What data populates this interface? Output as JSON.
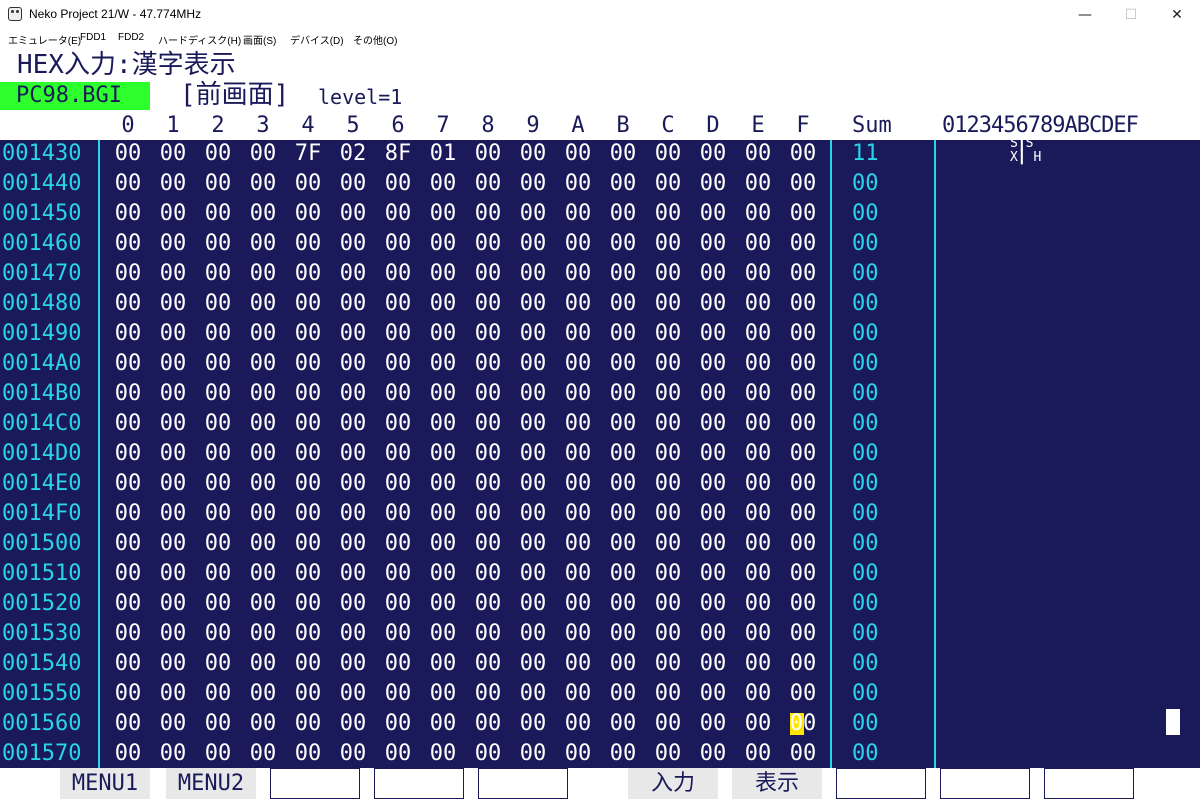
{
  "window": {
    "title": "Neko Project 21/W - 47.774MHz",
    "minimize_glyph": "—",
    "maximize_glyph": "☐",
    "close_glyph": "✕"
  },
  "menu": [
    "エミュレータ(E)",
    "FDD1",
    "FDD2",
    "ハードディスク(H)",
    "画面(S)",
    "デバイス(D)",
    "その他(O)"
  ],
  "editor": {
    "mode_title": "HEX入力:漢字表示",
    "file_name": "PC98.BGI",
    "screen_label": "[前画面]",
    "level_label": "level=1",
    "column_headers": [
      "0",
      "1",
      "2",
      "3",
      "4",
      "5",
      "6",
      "7",
      "8",
      "9",
      "A",
      "B",
      "C",
      "D",
      "E",
      "F"
    ],
    "sum_header": "Sum",
    "ascii_header": "0123456789ABCDEF",
    "rows": [
      {
        "addr": "001430",
        "bytes": [
          "00",
          "00",
          "00",
          "00",
          "7F",
          "02",
          "8F",
          "01",
          "00",
          "00",
          "00",
          "00",
          "00",
          "00",
          "00",
          "00"
        ],
        "sum": "11",
        "ascii": "S┃S\nX┃ H"
      },
      {
        "addr": "001440",
        "bytes": [
          "00",
          "00",
          "00",
          "00",
          "00",
          "00",
          "00",
          "00",
          "00",
          "00",
          "00",
          "00",
          "00",
          "00",
          "00",
          "00"
        ],
        "sum": "00",
        "ascii": ""
      },
      {
        "addr": "001450",
        "bytes": [
          "00",
          "00",
          "00",
          "00",
          "00",
          "00",
          "00",
          "00",
          "00",
          "00",
          "00",
          "00",
          "00",
          "00",
          "00",
          "00"
        ],
        "sum": "00",
        "ascii": ""
      },
      {
        "addr": "001460",
        "bytes": [
          "00",
          "00",
          "00",
          "00",
          "00",
          "00",
          "00",
          "00",
          "00",
          "00",
          "00",
          "00",
          "00",
          "00",
          "00",
          "00"
        ],
        "sum": "00",
        "ascii": ""
      },
      {
        "addr": "001470",
        "bytes": [
          "00",
          "00",
          "00",
          "00",
          "00",
          "00",
          "00",
          "00",
          "00",
          "00",
          "00",
          "00",
          "00",
          "00",
          "00",
          "00"
        ],
        "sum": "00",
        "ascii": ""
      },
      {
        "addr": "001480",
        "bytes": [
          "00",
          "00",
          "00",
          "00",
          "00",
          "00",
          "00",
          "00",
          "00",
          "00",
          "00",
          "00",
          "00",
          "00",
          "00",
          "00"
        ],
        "sum": "00",
        "ascii": ""
      },
      {
        "addr": "001490",
        "bytes": [
          "00",
          "00",
          "00",
          "00",
          "00",
          "00",
          "00",
          "00",
          "00",
          "00",
          "00",
          "00",
          "00",
          "00",
          "00",
          "00"
        ],
        "sum": "00",
        "ascii": ""
      },
      {
        "addr": "0014A0",
        "bytes": [
          "00",
          "00",
          "00",
          "00",
          "00",
          "00",
          "00",
          "00",
          "00",
          "00",
          "00",
          "00",
          "00",
          "00",
          "00",
          "00"
        ],
        "sum": "00",
        "ascii": ""
      },
      {
        "addr": "0014B0",
        "bytes": [
          "00",
          "00",
          "00",
          "00",
          "00",
          "00",
          "00",
          "00",
          "00",
          "00",
          "00",
          "00",
          "00",
          "00",
          "00",
          "00"
        ],
        "sum": "00",
        "ascii": ""
      },
      {
        "addr": "0014C0",
        "bytes": [
          "00",
          "00",
          "00",
          "00",
          "00",
          "00",
          "00",
          "00",
          "00",
          "00",
          "00",
          "00",
          "00",
          "00",
          "00",
          "00"
        ],
        "sum": "00",
        "ascii": ""
      },
      {
        "addr": "0014D0",
        "bytes": [
          "00",
          "00",
          "00",
          "00",
          "00",
          "00",
          "00",
          "00",
          "00",
          "00",
          "00",
          "00",
          "00",
          "00",
          "00",
          "00"
        ],
        "sum": "00",
        "ascii": ""
      },
      {
        "addr": "0014E0",
        "bytes": [
          "00",
          "00",
          "00",
          "00",
          "00",
          "00",
          "00",
          "00",
          "00",
          "00",
          "00",
          "00",
          "00",
          "00",
          "00",
          "00"
        ],
        "sum": "00",
        "ascii": ""
      },
      {
        "addr": "0014F0",
        "bytes": [
          "00",
          "00",
          "00",
          "00",
          "00",
          "00",
          "00",
          "00",
          "00",
          "00",
          "00",
          "00",
          "00",
          "00",
          "00",
          "00"
        ],
        "sum": "00",
        "ascii": ""
      },
      {
        "addr": "001500",
        "bytes": [
          "00",
          "00",
          "00",
          "00",
          "00",
          "00",
          "00",
          "00",
          "00",
          "00",
          "00",
          "00",
          "00",
          "00",
          "00",
          "00"
        ],
        "sum": "00",
        "ascii": ""
      },
      {
        "addr": "001510",
        "bytes": [
          "00",
          "00",
          "00",
          "00",
          "00",
          "00",
          "00",
          "00",
          "00",
          "00",
          "00",
          "00",
          "00",
          "00",
          "00",
          "00"
        ],
        "sum": "00",
        "ascii": ""
      },
      {
        "addr": "001520",
        "bytes": [
          "00",
          "00",
          "00",
          "00",
          "00",
          "00",
          "00",
          "00",
          "00",
          "00",
          "00",
          "00",
          "00",
          "00",
          "00",
          "00"
        ],
        "sum": "00",
        "ascii": ""
      },
      {
        "addr": "001530",
        "bytes": [
          "00",
          "00",
          "00",
          "00",
          "00",
          "00",
          "00",
          "00",
          "00",
          "00",
          "00",
          "00",
          "00",
          "00",
          "00",
          "00"
        ],
        "sum": "00",
        "ascii": ""
      },
      {
        "addr": "001540",
        "bytes": [
          "00",
          "00",
          "00",
          "00",
          "00",
          "00",
          "00",
          "00",
          "00",
          "00",
          "00",
          "00",
          "00",
          "00",
          "00",
          "00"
        ],
        "sum": "00",
        "ascii": ""
      },
      {
        "addr": "001550",
        "bytes": [
          "00",
          "00",
          "00",
          "00",
          "00",
          "00",
          "00",
          "00",
          "00",
          "00",
          "00",
          "00",
          "00",
          "00",
          "00",
          "00"
        ],
        "sum": "00",
        "ascii": ""
      },
      {
        "addr": "001560",
        "bytes": [
          "00",
          "00",
          "00",
          "00",
          "00",
          "00",
          "00",
          "00",
          "00",
          "00",
          "00",
          "00",
          "00",
          "00",
          "00",
          "00"
        ],
        "sum": "00",
        "ascii": "",
        "cursor_col": 15,
        "text_cursor": true
      },
      {
        "addr": "001570",
        "bytes": [
          "00",
          "00",
          "00",
          "00",
          "00",
          "00",
          "00",
          "00",
          "00",
          "00",
          "00",
          "00",
          "00",
          "00",
          "00",
          "00"
        ],
        "sum": "00",
        "ascii": ""
      }
    ],
    "function_keys": [
      "MENU1",
      "MENU2",
      "",
      "",
      "",
      "入力",
      "表示",
      "",
      "",
      ""
    ]
  },
  "colors": {
    "screen_bg": "#1a1a5a",
    "accent_cyan": "#29d4e8",
    "file_badge_green": "#2dff2d",
    "cursor_yellow": "#ffe500"
  }
}
